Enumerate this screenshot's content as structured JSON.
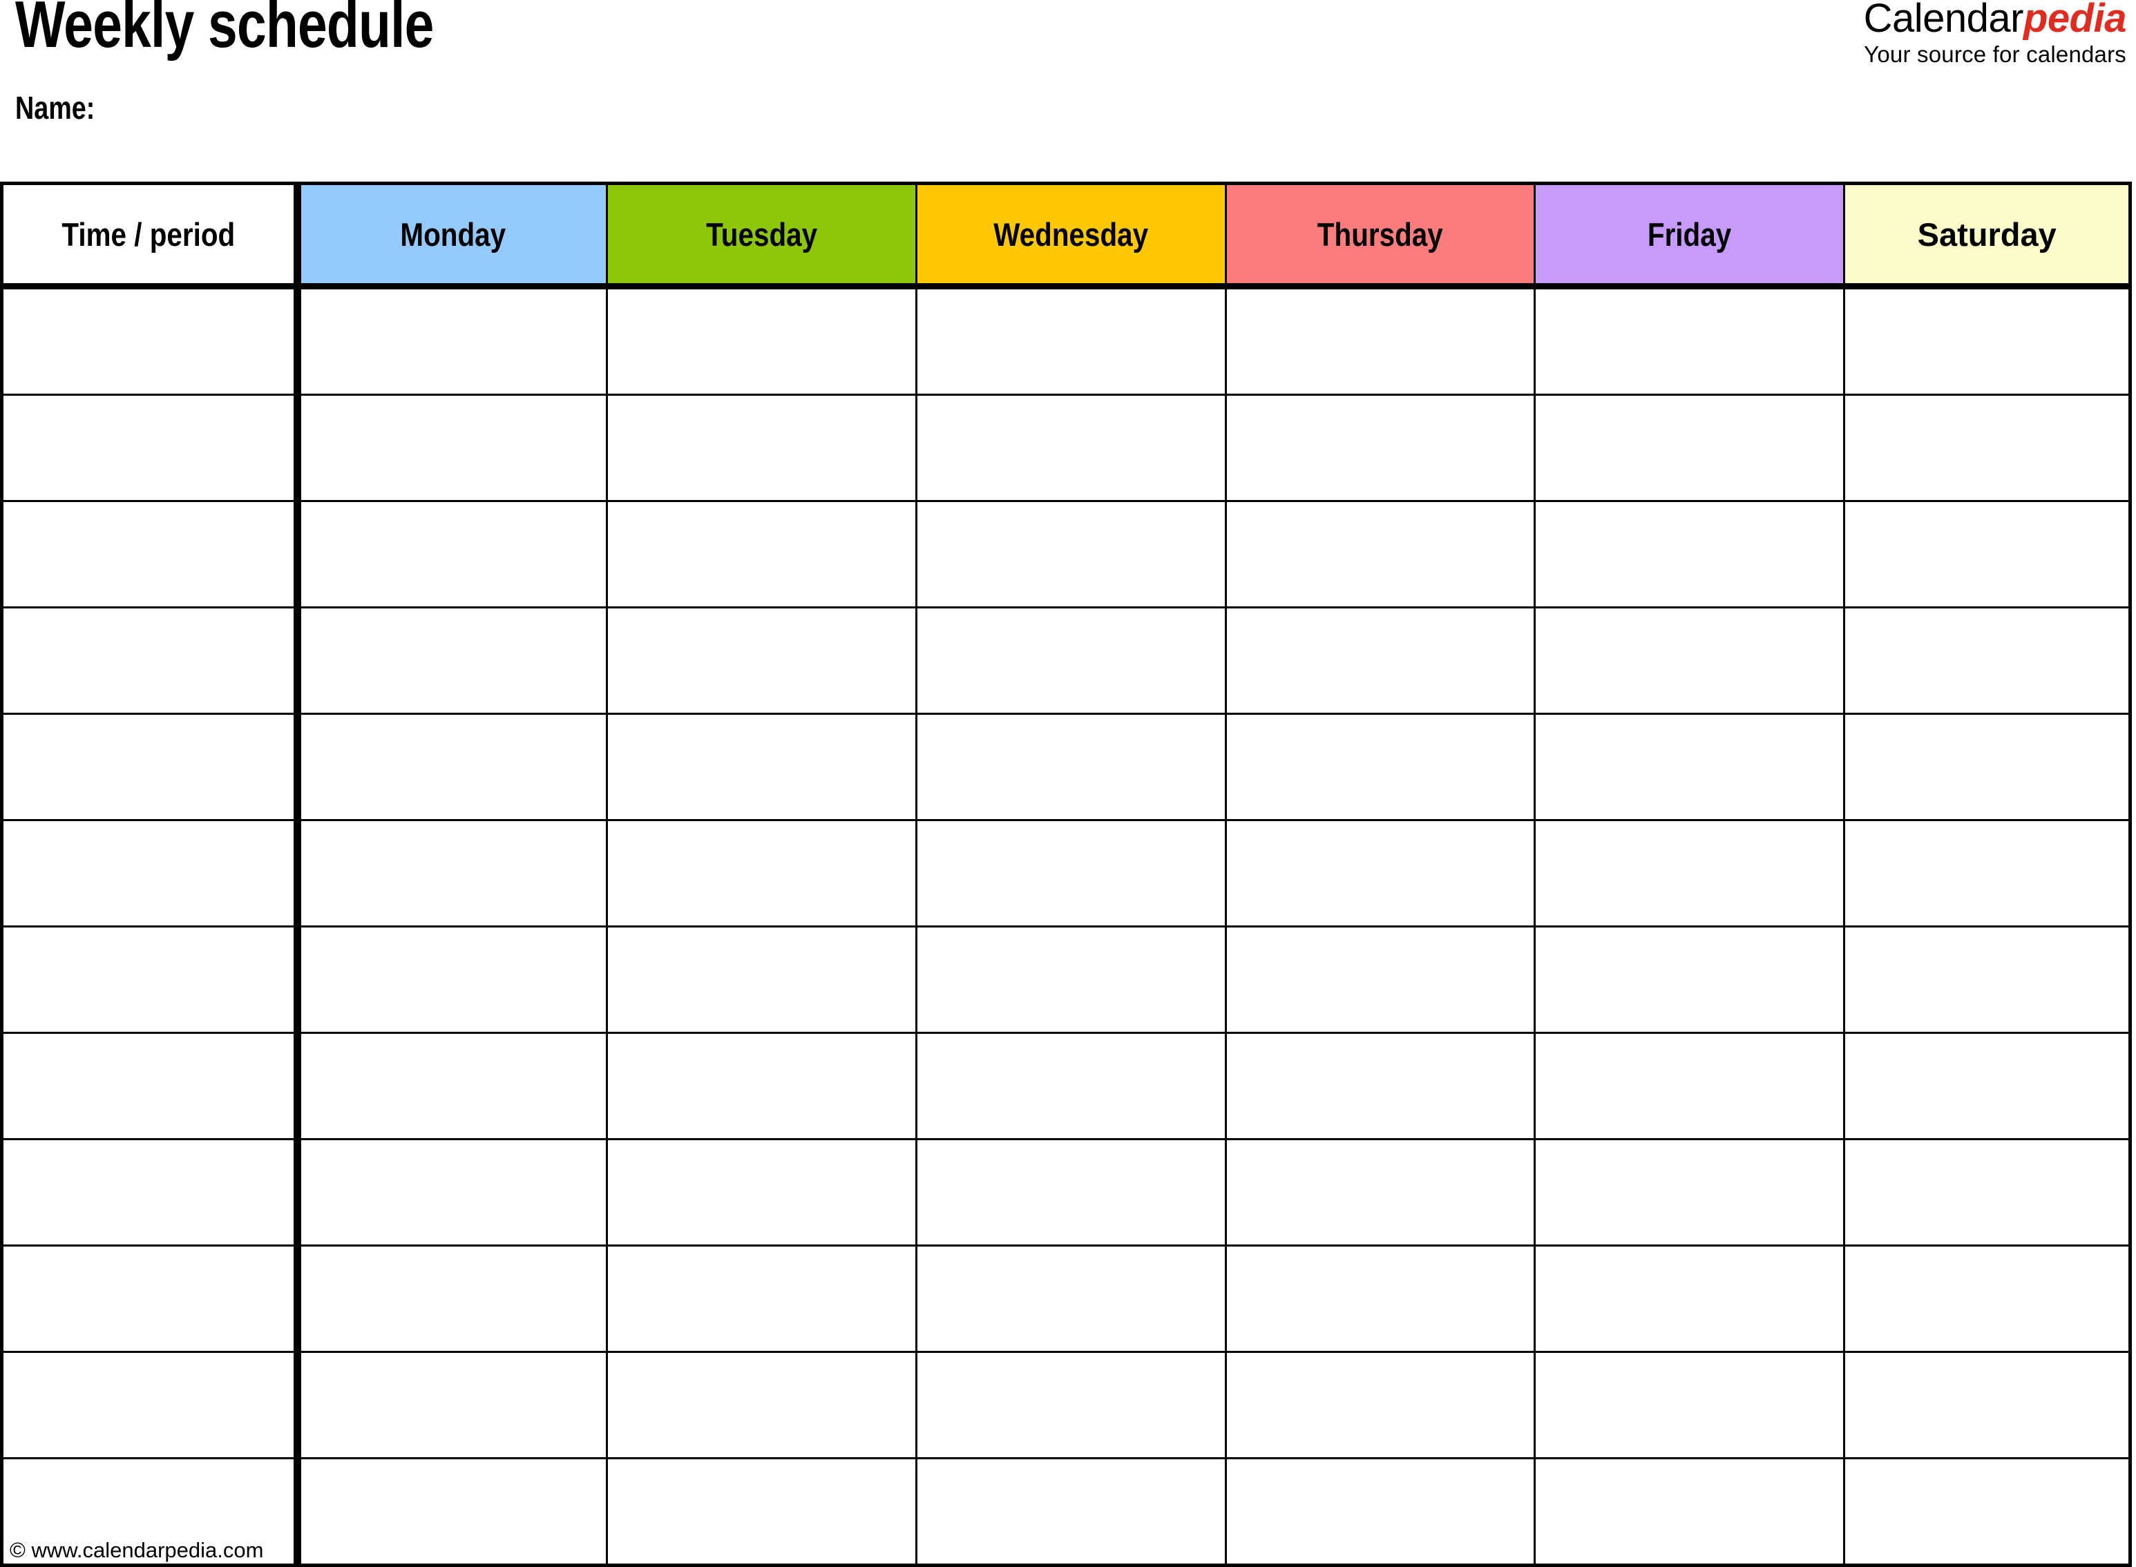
{
  "document": {
    "title": "Weekly schedule",
    "name_label": "Name:",
    "name_value": ""
  },
  "brand": {
    "name_part1": "Calendar",
    "name_part2": "pedia",
    "tagline": "Your source for calendars",
    "accent_color": "#e02b20"
  },
  "table": {
    "columns": [
      {
        "label": "Time / period",
        "color": "#ffffff",
        "key": "time"
      },
      {
        "label": "Monday",
        "color": "#93c9fb",
        "key": "monday"
      },
      {
        "label": "Tuesday",
        "color": "#8dc707",
        "key": "tuesday"
      },
      {
        "label": "Wednesday",
        "color": "#ffc800",
        "key": "wednesday"
      },
      {
        "label": "Thursday",
        "color": "#fa7c7c",
        "key": "thursday"
      },
      {
        "label": "Friday",
        "color": "#c79bfb",
        "key": "friday"
      },
      {
        "label": "Saturday",
        "color": "#fcfcc8",
        "key": "saturday"
      }
    ],
    "row_count": 12,
    "rows": [
      {
        "time": "",
        "monday": "",
        "tuesday": "",
        "wednesday": "",
        "thursday": "",
        "friday": "",
        "saturday": ""
      },
      {
        "time": "",
        "monday": "",
        "tuesday": "",
        "wednesday": "",
        "thursday": "",
        "friday": "",
        "saturday": ""
      },
      {
        "time": "",
        "monday": "",
        "tuesday": "",
        "wednesday": "",
        "thursday": "",
        "friday": "",
        "saturday": ""
      },
      {
        "time": "",
        "monday": "",
        "tuesday": "",
        "wednesday": "",
        "thursday": "",
        "friday": "",
        "saturday": ""
      },
      {
        "time": "",
        "monday": "",
        "tuesday": "",
        "wednesday": "",
        "thursday": "",
        "friday": "",
        "saturday": ""
      },
      {
        "time": "",
        "monday": "",
        "tuesday": "",
        "wednesday": "",
        "thursday": "",
        "friday": "",
        "saturday": ""
      },
      {
        "time": "",
        "monday": "",
        "tuesday": "",
        "wednesday": "",
        "thursday": "",
        "friday": "",
        "saturday": ""
      },
      {
        "time": "",
        "monday": "",
        "tuesday": "",
        "wednesday": "",
        "thursday": "",
        "friday": "",
        "saturday": ""
      },
      {
        "time": "",
        "monday": "",
        "tuesday": "",
        "wednesday": "",
        "thursday": "",
        "friday": "",
        "saturday": ""
      },
      {
        "time": "",
        "monday": "",
        "tuesday": "",
        "wednesday": "",
        "thursday": "",
        "friday": "",
        "saturday": ""
      },
      {
        "time": "",
        "monday": "",
        "tuesday": "",
        "wednesday": "",
        "thursday": "",
        "friday": "",
        "saturday": ""
      },
      {
        "time": "",
        "monday": "",
        "tuesday": "",
        "wednesday": "",
        "thursday": "",
        "friday": "",
        "saturday": ""
      }
    ]
  },
  "footer": {
    "copyright": "© www.calendarpedia.com"
  }
}
